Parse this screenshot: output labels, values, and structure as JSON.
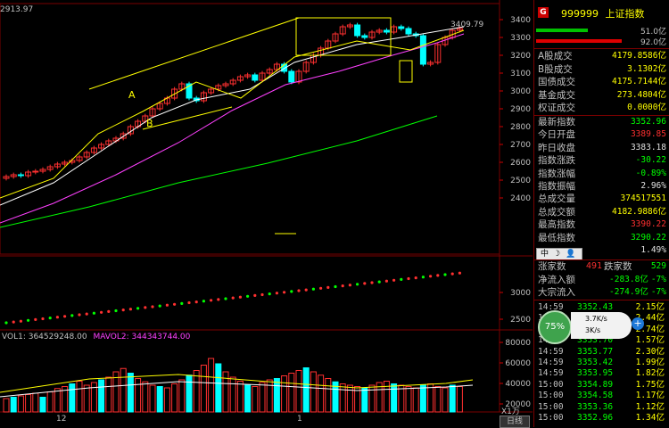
{
  "top_left_value": "2913.97",
  "annotations": {
    "A": "A",
    "B": "B",
    "peak": "3409.79"
  },
  "price_axis": [
    "3400",
    "3300",
    "3200",
    "3100",
    "3000",
    "2900",
    "2800",
    "2700",
    "2600",
    "2500",
    "2400"
  ],
  "mid_axis": [
    "3000",
    "2500"
  ],
  "vol_axis": [
    "80000",
    "60000",
    "40000",
    "20000"
  ],
  "vol_label": {
    "vol": "VOL1: 364529248.00",
    "mavol": "MAVOL2: 344343744.00"
  },
  "x_labels": {
    "dec": "12",
    "jan": "1"
  },
  "x_unit": "X1万",
  "day_tab": "日线",
  "quote": {
    "badge": "G",
    "code": "999999",
    "name": "上证指数",
    "bar1": "51.0亿",
    "bar2": "92.0亿",
    "rows1": [
      {
        "label": "A股成交",
        "value": "4179.8586亿",
        "color": "#ffff00"
      },
      {
        "label": "B股成交",
        "value": "3.1302亿",
        "color": "#ffff00"
      },
      {
        "label": "国债成交",
        "value": "4175.7144亿",
        "color": "#ffff00"
      },
      {
        "label": "基金成交",
        "value": "273.4804亿",
        "color": "#ffff00"
      },
      {
        "label": "权证成交",
        "value": "0.0000亿",
        "color": "#ffff00"
      }
    ],
    "rows2": [
      {
        "label": "最新指数",
        "value": "3352.96",
        "color": "#00ff00"
      },
      {
        "label": "今日开盘",
        "value": "3389.85",
        "color": "#ff3030"
      },
      {
        "label": "昨日收盘",
        "value": "3383.18",
        "color": "#e0e0e0"
      },
      {
        "label": "指数涨跌",
        "value": "-30.22",
        "color": "#00ff00"
      },
      {
        "label": "指数涨幅",
        "value": "-0.89%",
        "color": "#00ff00"
      },
      {
        "label": "指数振幅",
        "value": "2.96%",
        "color": "#e0e0e0"
      },
      {
        "label": "总成交量",
        "value": "374517551",
        "color": "#ffff00"
      },
      {
        "label": "总成交额",
        "value": "4182.9886亿",
        "color": "#ffff00"
      },
      {
        "label": "最高指数",
        "value": "3390.22",
        "color": "#ff3030"
      },
      {
        "label": "最低指数",
        "value": "3290.22",
        "color": "#00ff00"
      }
    ],
    "extra_pct": "1.49%",
    "toolbar": {
      "zh": "中",
      "moon": "☽",
      "user": "👤"
    },
    "updown": {
      "up_label": "涨家数",
      "up": "491",
      "down_label": "跌家数",
      "down": "529"
    },
    "flow": [
      {
        "label": "净流入额",
        "value": "-283.8亿",
        "pct": "-7%"
      },
      {
        "label": "大宗流入",
        "value": "-274.9亿",
        "pct": "-7%"
      }
    ],
    "ticks": [
      {
        "time": "14:59",
        "price": "3352.43",
        "vol": "2.15亿"
      },
      {
        "time": "14:59",
        "price": "",
        "vol": "2.44亿"
      },
      {
        "time": "14:59",
        "price": "",
        "vol": "2.74亿"
      },
      {
        "time": "14:59",
        "price": "3353.70",
        "vol": "1.57亿"
      },
      {
        "time": "14:59",
        "price": "3353.77",
        "vol": "2.30亿"
      },
      {
        "time": "14:59",
        "price": "3353.42",
        "vol": "1.99亿"
      },
      {
        "time": "14:59",
        "price": "3353.95",
        "vol": "1.82亿"
      },
      {
        "time": "15:00",
        "price": "3354.89",
        "vol": "1.75亿"
      },
      {
        "time": "15:00",
        "price": "3354.58",
        "vol": "1.17亿"
      },
      {
        "time": "15:00",
        "price": "3353.36",
        "vol": "1.12亿"
      },
      {
        "time": "15:00",
        "price": "3352.96",
        "vol": "1.34亿"
      }
    ],
    "speed": {
      "pct": "75%",
      "up": "3.7K/s",
      "down": "3K/s",
      "plus": "+"
    }
  }
}
